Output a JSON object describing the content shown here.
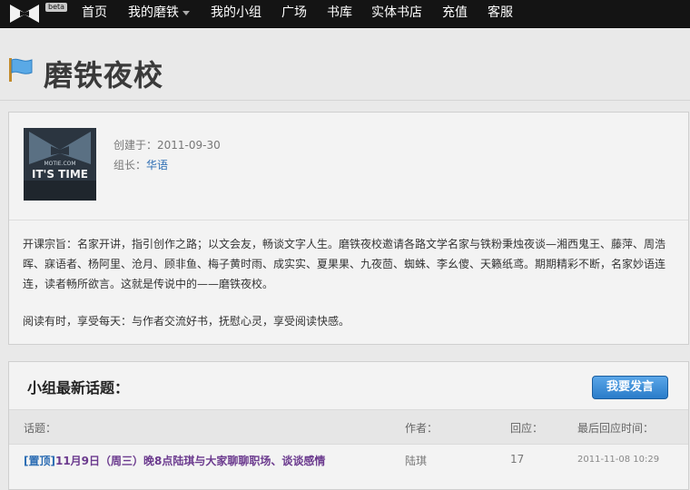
{
  "nav": {
    "beta": "beta",
    "items": [
      {
        "label": "首页"
      },
      {
        "label": "我的磨铁"
      },
      {
        "label": "我的小组"
      },
      {
        "label": "广场"
      },
      {
        "label": "书库"
      },
      {
        "label": "实体书店"
      },
      {
        "label": "充值"
      },
      {
        "label": "客服"
      }
    ]
  },
  "page": {
    "title": "磨铁夜校"
  },
  "group": {
    "created_label": "创建于：",
    "created_date": "2011-09-30",
    "leader_label": "组长：",
    "leader_name": "华语",
    "avatar_text_top": "MOTIE.COM",
    "avatar_text_main": "IT'S TIME",
    "description_1": "开课宗旨：名家开讲，指引创作之路；以文会友，畅谈文字人生。磨铁夜校邀请各路文学名家与铁粉秉烛夜谈—湘西鬼王、藤萍、周浩晖、寐语者、杨阿里、沧月、顾非鱼、梅子黄时雨、成实实、夏果果、九夜茴、蜘蛛、李幺傻、天籁纸鸢。期期精彩不断，名家妙语连连，读者畅所欲言。这就是传说中的——磨铁夜校。",
    "description_2": "阅读有时，享受每天：与作者交流好书，抚慰心灵，享受阅读快感。"
  },
  "topics": {
    "title": "小组最新话题：",
    "post_button": "我要发言",
    "headers": {
      "topic": "话题：",
      "author": "作者：",
      "replies": "回应：",
      "last_reply": "最后回应时间："
    },
    "rows": [
      {
        "sticky": "[置顶]",
        "title": "11月9日（周三）晚8点陆琪与大家聊聊职场、谈谈感情",
        "author": "陆琪",
        "replies": "17",
        "last_reply": "2011-11-08 10:29"
      }
    ]
  },
  "colors": {
    "topbar": "#141414",
    "link": "#2b6cb3",
    "topic_link": "#6b3a8e",
    "button": "#2a7cc9"
  }
}
